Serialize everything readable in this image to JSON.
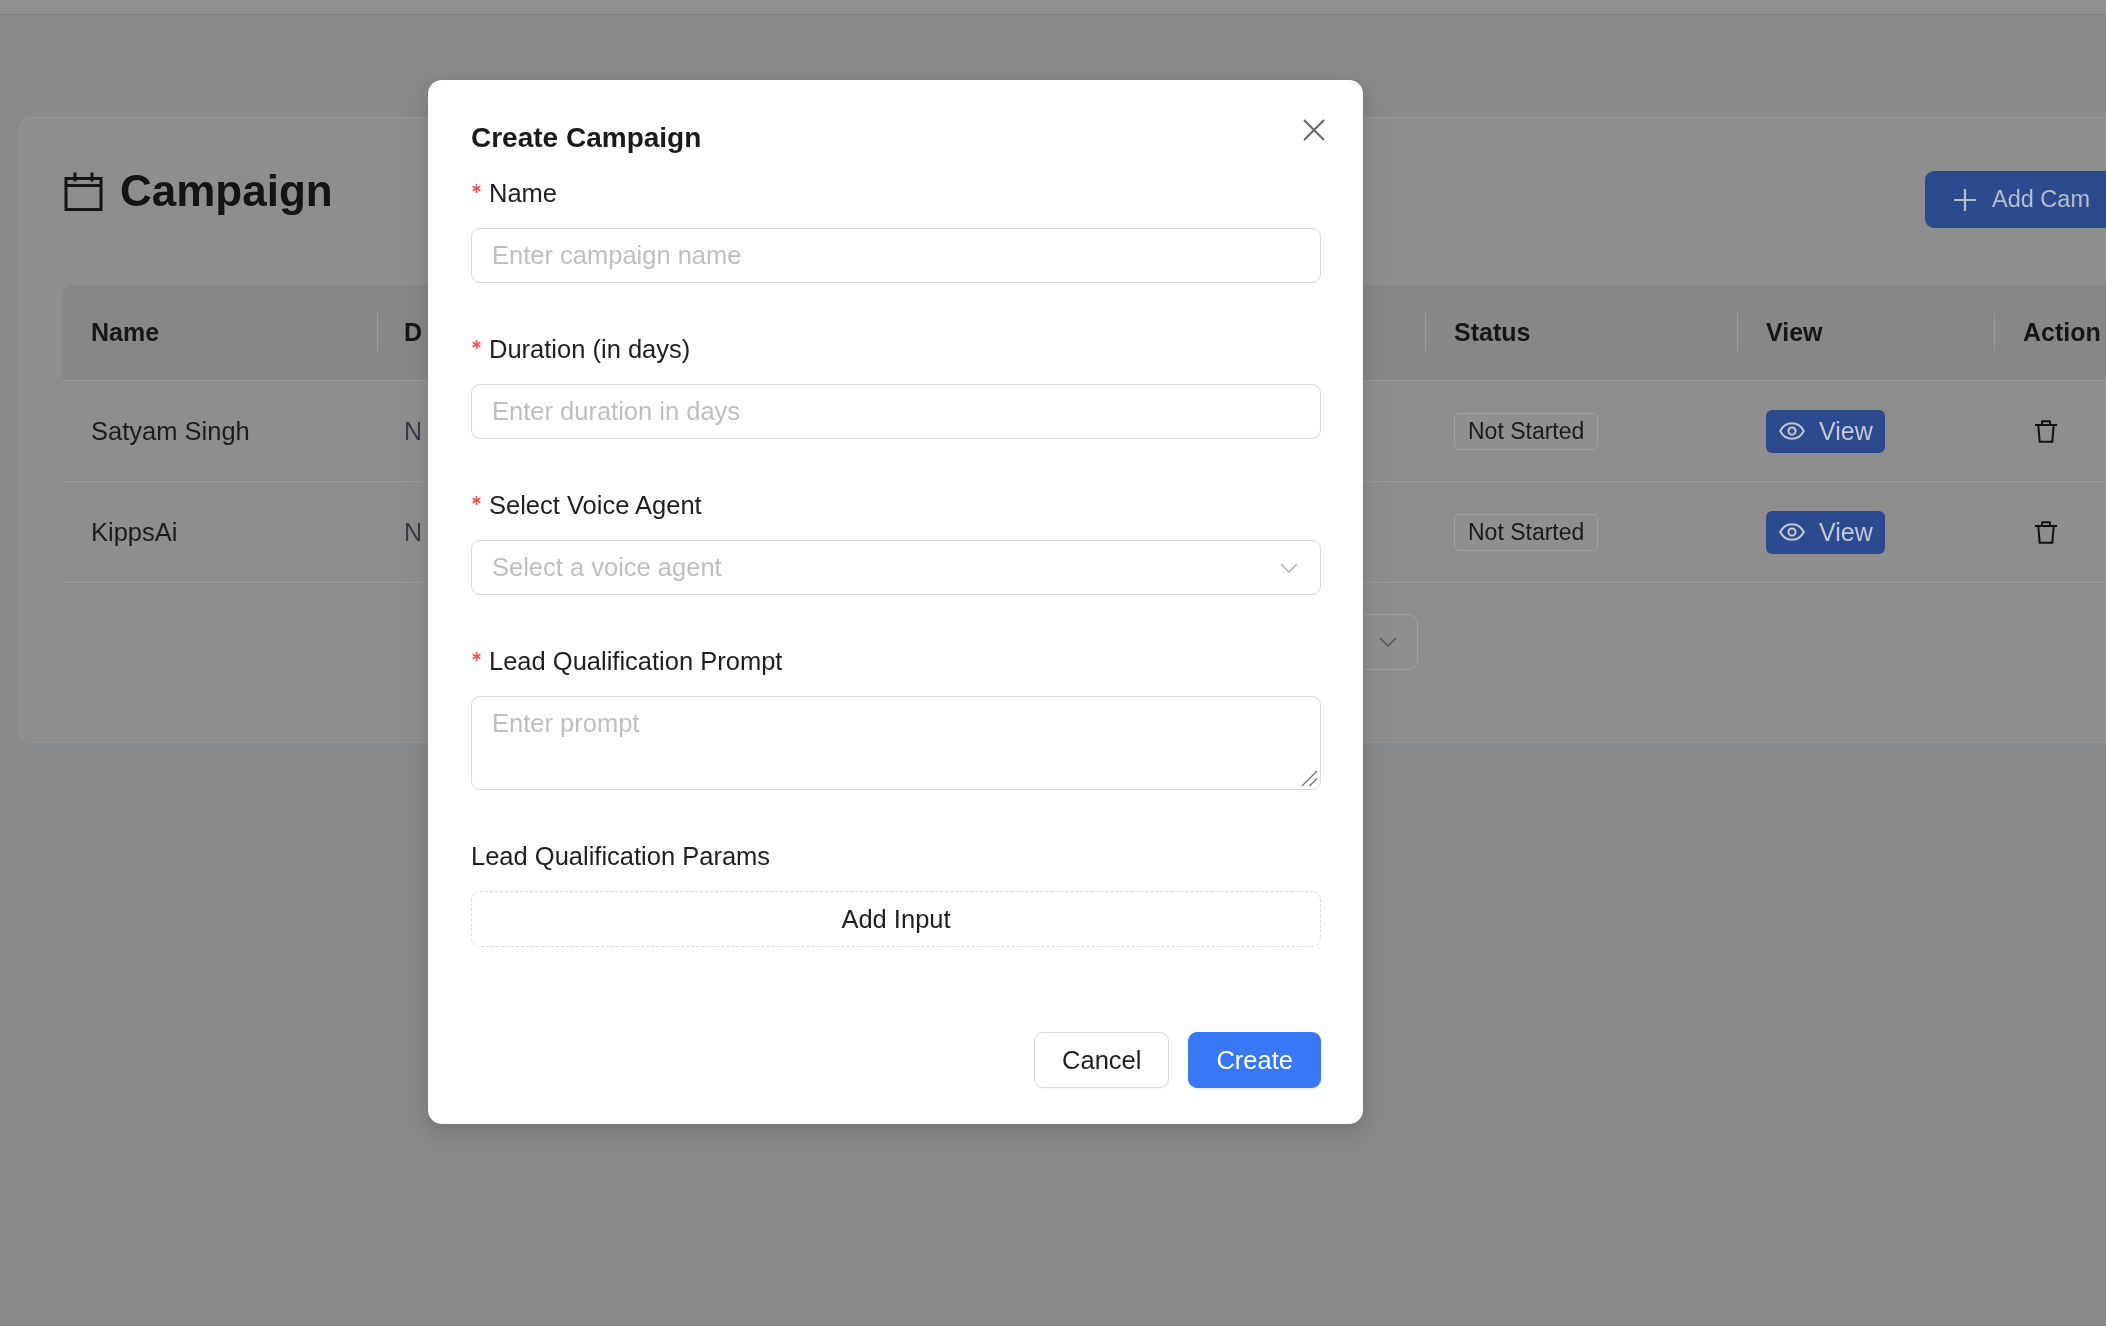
{
  "page": {
    "title": "Campaign",
    "add_button": "Add Cam"
  },
  "table": {
    "columns": [
      "Name",
      "D",
      "Status",
      "View",
      "Action"
    ],
    "rows": [
      {
        "name": "Satyam Singh",
        "column_2": "N",
        "status": "Not Started",
        "view_button": "View"
      },
      {
        "name": "KippsAi",
        "column_2": "N",
        "status": "Not Started",
        "view_button": "View"
      }
    ]
  },
  "modal": {
    "title": "Create Campaign",
    "fields": [
      {
        "kind": "input",
        "label": "Name",
        "required": true,
        "placeholder": "Enter campaign name"
      },
      {
        "kind": "input",
        "label": "Duration (in days)",
        "required": true,
        "placeholder": "Enter duration in days"
      },
      {
        "kind": "select",
        "label": "Select Voice Agent",
        "required": true,
        "placeholder": "Select a voice agent"
      },
      {
        "kind": "textarea",
        "label": "Lead Qualification Prompt",
        "required": true,
        "placeholder": "Enter prompt"
      },
      {
        "kind": "add_button",
        "label": "Lead Qualification Params",
        "required": false,
        "button_label": "Add Input"
      }
    ],
    "buttons": [
      {
        "kind": "default",
        "label": "Cancel"
      },
      {
        "kind": "primary",
        "label": "Create"
      }
    ]
  }
}
